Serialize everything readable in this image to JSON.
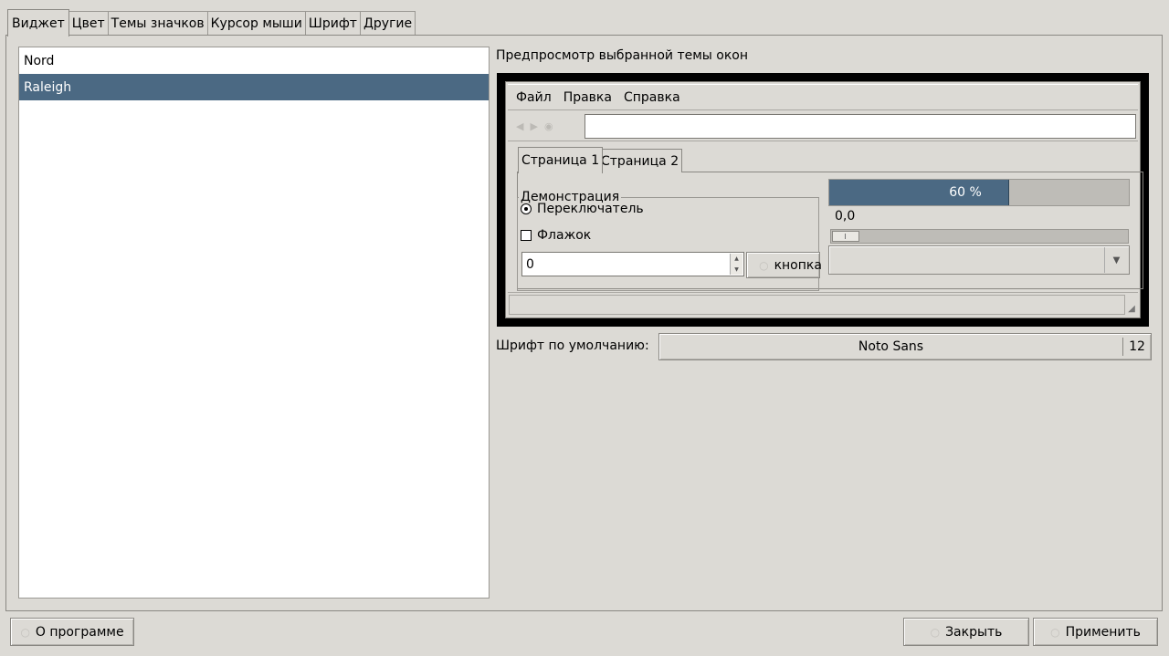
{
  "tabs": [
    "Виджет",
    "Цвет",
    "Темы значков",
    "Курсор мыши",
    "Шрифт",
    "Другие"
  ],
  "active_tab": 0,
  "themes": {
    "items": [
      "Nord",
      "Raleigh"
    ],
    "selected": 1
  },
  "preview": {
    "label": "Предпросмотр выбранной темы окон",
    "menu": [
      "Файл",
      "Правка",
      "Справка"
    ],
    "tabs": [
      "Страница 1",
      "Страница 2"
    ],
    "group_title": "Демонстрация",
    "radio_label": "Переключатель",
    "checkbox_label": "Флажок",
    "spin_value": "0",
    "button_label": "кнопка",
    "progress": {
      "value": 60,
      "text": "60 %"
    },
    "scale_value": "0,0"
  },
  "font_row": {
    "label": "Шрифт по умолчанию:",
    "font_name": "Noto Sans",
    "font_size": "12"
  },
  "bottom": {
    "about": "О программе",
    "close": "Закрыть",
    "apply": "Применить"
  },
  "colors": {
    "selection": "#4b6983",
    "background": "#dcdad5"
  }
}
